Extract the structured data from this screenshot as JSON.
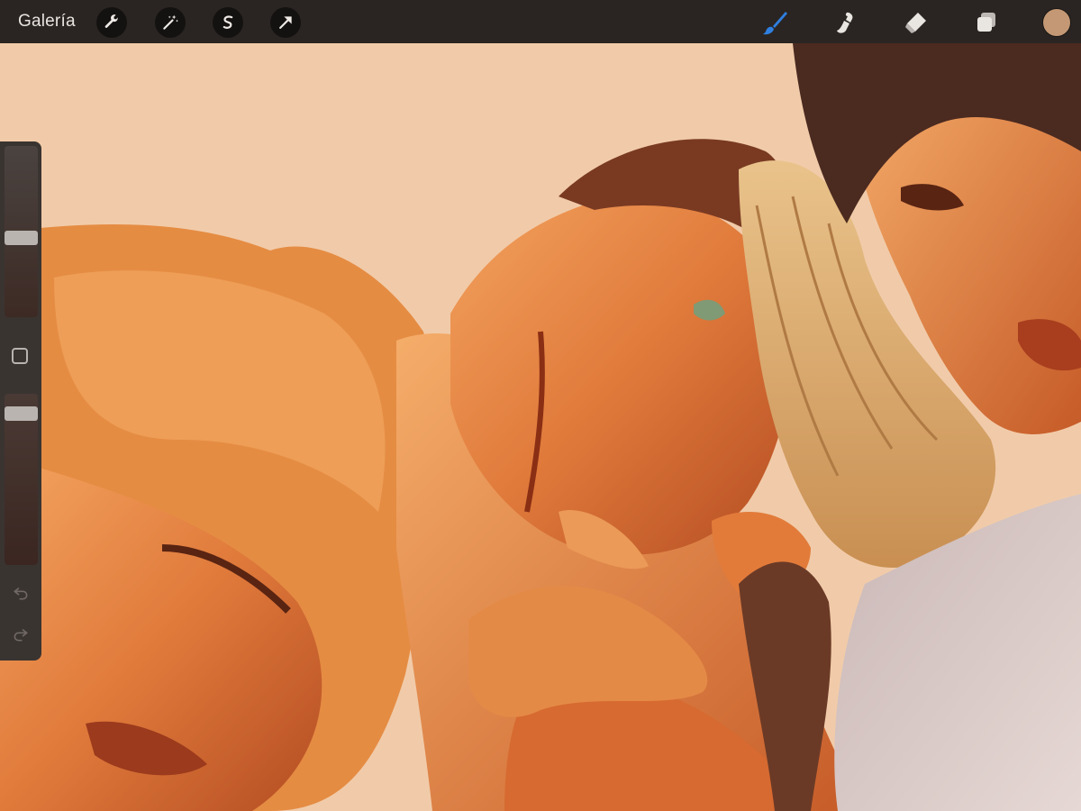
{
  "toolbar": {
    "gallery_label": "Galería",
    "left_tools": [
      "wrench-icon",
      "magic-wand-icon",
      "selection-icon",
      "move-arrow-icon"
    ],
    "right_tools": [
      "brush-icon",
      "smudge-icon",
      "eraser-icon",
      "layers-icon"
    ],
    "active_tool": "brush",
    "active_tool_color": "#2f7fe0",
    "current_color": "#c49874"
  },
  "sidebar": {
    "brush_size_fraction": 0.46,
    "opacity_fraction": 0.92,
    "undo_icon": "undo-icon",
    "redo_icon": "redo-icon"
  },
  "canvas": {
    "background_color": "#f1cba9"
  }
}
